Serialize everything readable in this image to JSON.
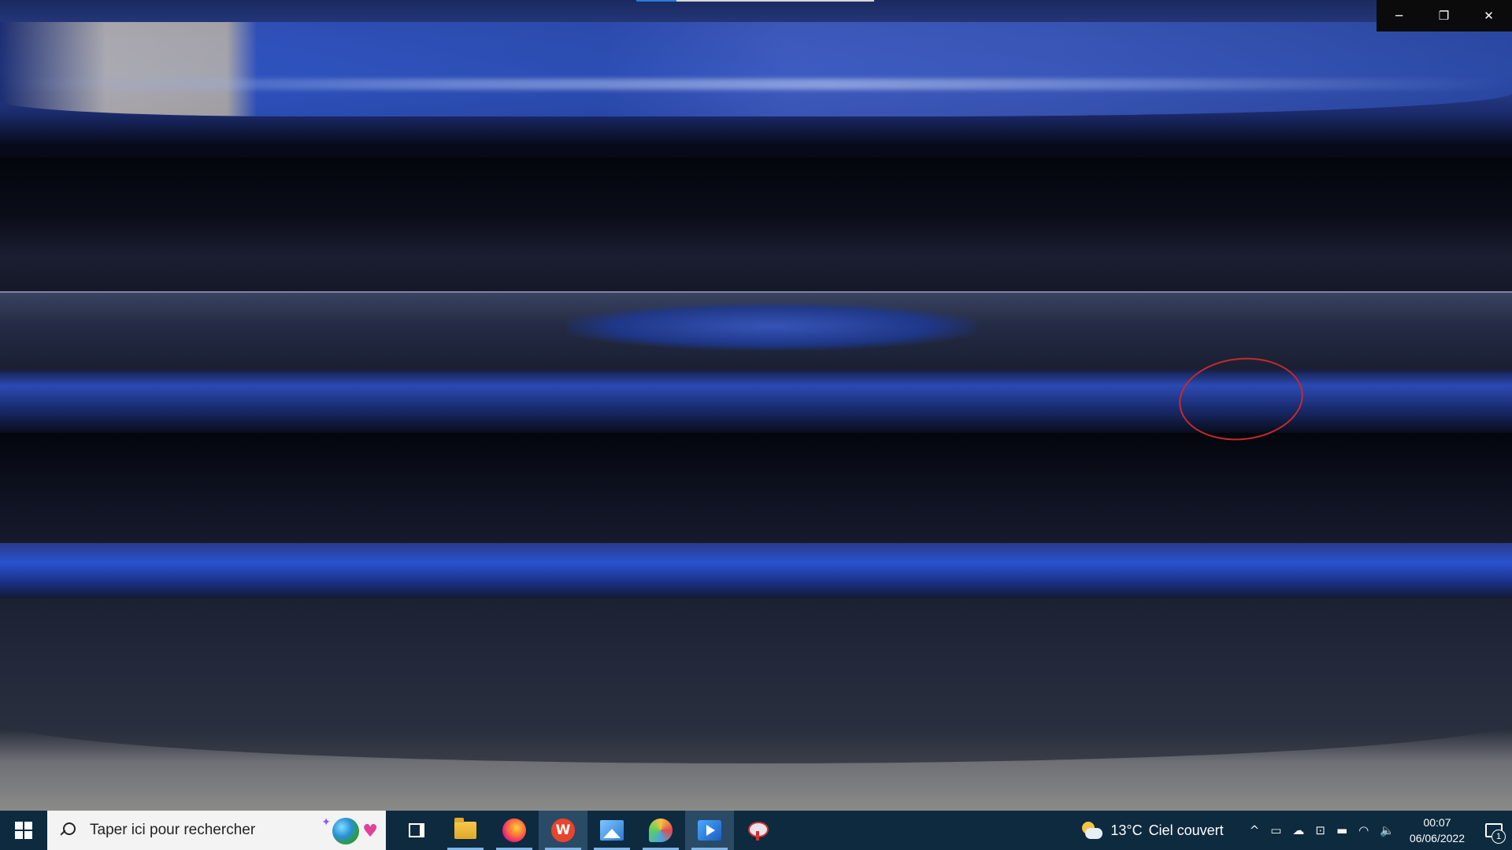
{
  "window": {
    "minimize_glyph": "─",
    "restore_glyph": "❐",
    "close_glyph": "✕",
    "playback_progress": 0.17
  },
  "taskbar": {
    "search_placeholder": "Taper ici pour rechercher",
    "apps": [
      {
        "name": "task-view-icon"
      },
      {
        "name": "file-explorer-icon"
      },
      {
        "name": "firefox-icon"
      },
      {
        "name": "w-app-icon",
        "label": "W"
      },
      {
        "name": "photos-icon"
      },
      {
        "name": "paint-icon"
      },
      {
        "name": "video-editor-icon"
      },
      {
        "name": "snipping-tool-icon"
      }
    ],
    "weather": {
      "temperature": "13°C",
      "condition": "Ciel couvert"
    },
    "tray_icons": {
      "chevron": "^",
      "meet": "▭",
      "onedrive": "☁",
      "security": "⊡",
      "battery": "▬",
      "wifi": "◠",
      "volume": "🔈"
    },
    "clock": {
      "time": "00:07",
      "date": "06/06/2022"
    },
    "notification_count": "1"
  },
  "colors": {
    "taskbar_bg": "#0d2a3f",
    "annotation_circle": "#c72a2a",
    "car_paint": "#2d4aa0"
  }
}
